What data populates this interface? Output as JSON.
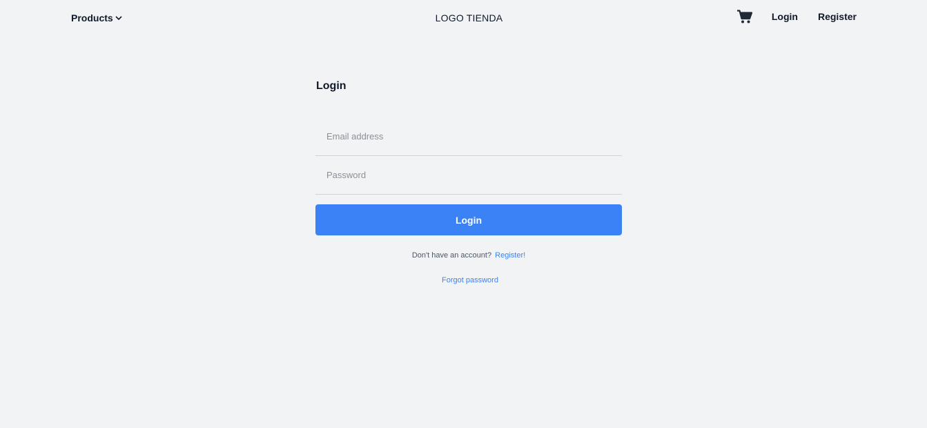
{
  "navbar": {
    "products_label": "Products",
    "products_icon": "chevron-down-icon",
    "logo_text": "LOGO TIENDA",
    "cart_icon": "cart-icon",
    "login_label": "Login",
    "register_label": "Register"
  },
  "login_form": {
    "title": "Login",
    "email_placeholder": "Email address",
    "email_value": "",
    "password_placeholder": "Password",
    "password_value": "",
    "submit_label": "Login",
    "no_account_text": "Don't have an account?",
    "register_link": "Register!",
    "forgot_link": "Forgot password"
  },
  "colors": {
    "background": "#f2f3f5",
    "primary": "#3b82f6",
    "text": "#111827"
  }
}
